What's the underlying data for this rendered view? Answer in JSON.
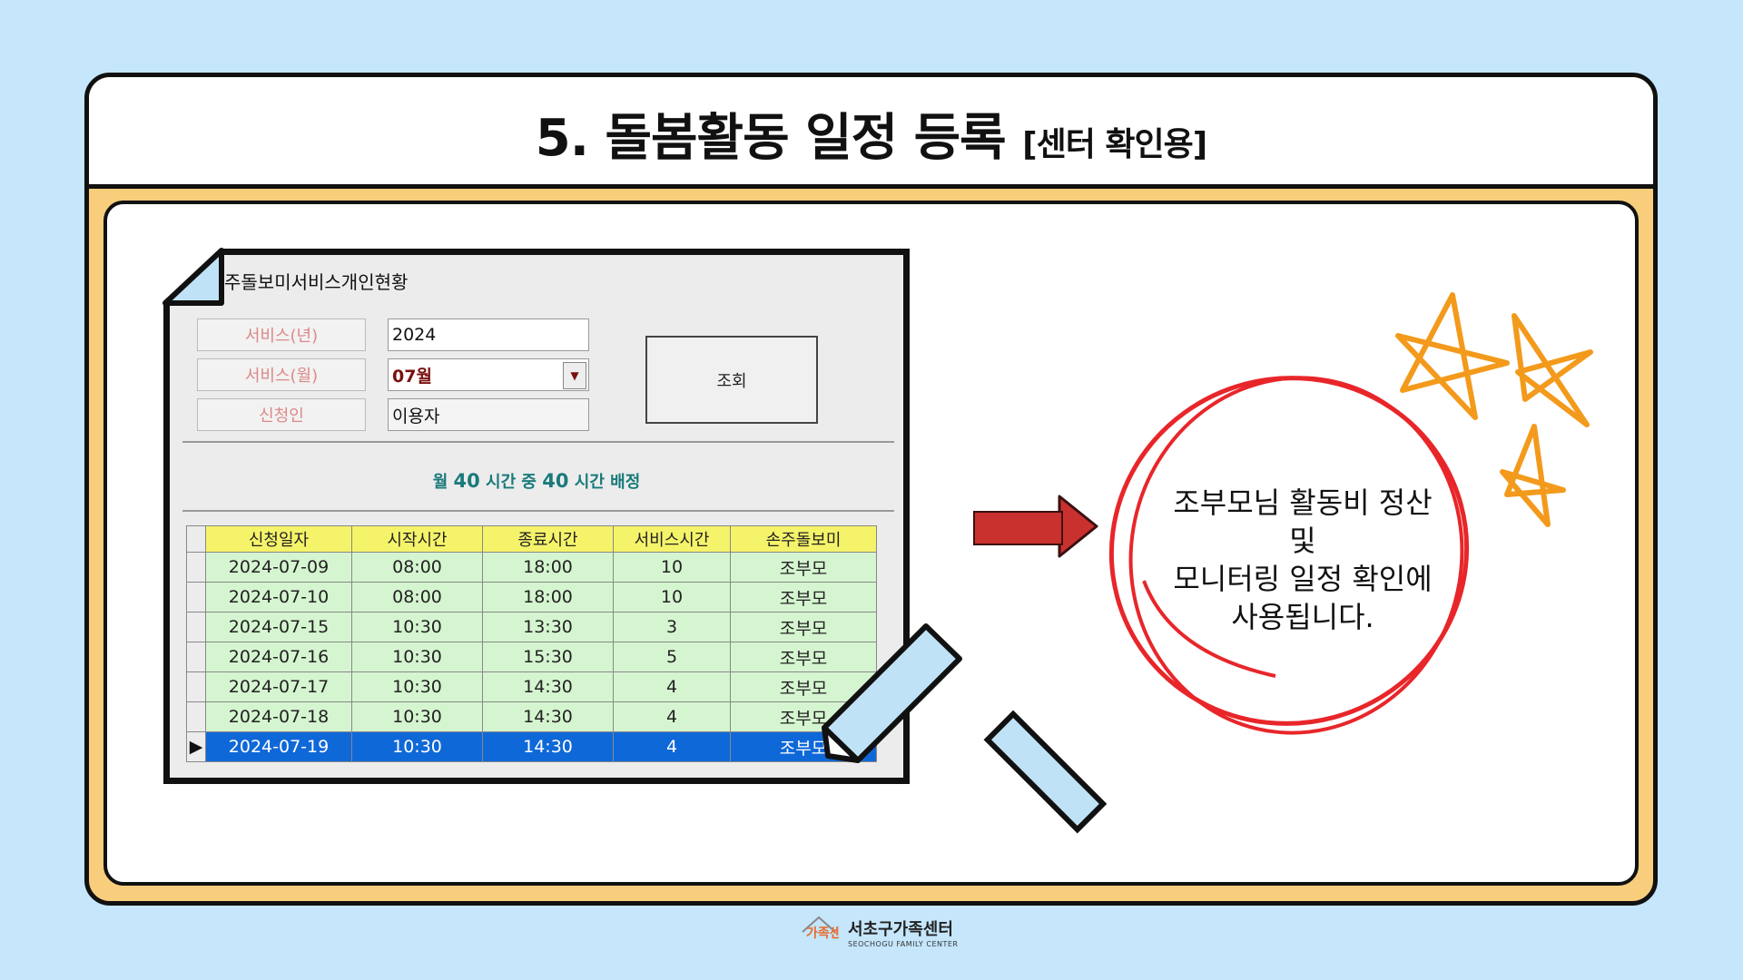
{
  "slide": {
    "title": "5. 돌봄활동 일정 등록",
    "title_sub": "[센터 확인용]",
    "note_lines": [
      "조부모님 활동비 정산",
      "및",
      "모니터링 일정 확인에",
      "사용됩니다."
    ]
  },
  "app": {
    "logo": "W",
    "window_title": "주돌보미서비스개인현황",
    "labels": {
      "year": "서비스(년)",
      "month": "서비스(월)",
      "applicant": "신청인"
    },
    "fields": {
      "year": "2024",
      "month": "07월",
      "applicant": "이용자"
    },
    "query_button": "조회",
    "allocation": {
      "prefix": "월",
      "total": "40",
      "middle": "시간 중",
      "assigned": "40",
      "suffix": "시간 배정"
    },
    "table": {
      "headers": [
        "신청일자",
        "시작시간",
        "종료시간",
        "서비스시간",
        "손주돌보미"
      ],
      "rows": [
        [
          "2024-07-09",
          "08:00",
          "18:00",
          "10",
          "조부모"
        ],
        [
          "2024-07-10",
          "08:00",
          "18:00",
          "10",
          "조부모"
        ],
        [
          "2024-07-15",
          "10:30",
          "13:30",
          "3",
          "조부모"
        ],
        [
          "2024-07-16",
          "10:30",
          "15:30",
          "5",
          "조부모"
        ],
        [
          "2024-07-17",
          "10:30",
          "14:30",
          "4",
          "조부모"
        ],
        [
          "2024-07-18",
          "10:30",
          "14:30",
          "4",
          "조부모"
        ],
        [
          "2024-07-19",
          "10:30",
          "14:30",
          "4",
          "조부모"
        ]
      ],
      "selected_row": 6
    }
  },
  "footer": {
    "logo_text": "가족센터",
    "name": "서초구가족센터",
    "eng": "SEOCHOGU FAMILY CENTER"
  },
  "colors": {
    "background": "#c5e6fb",
    "frame": "#f8cd7c",
    "arrow": "#c9312f",
    "circle": "#e8262a",
    "stars": "#f39a1c"
  }
}
